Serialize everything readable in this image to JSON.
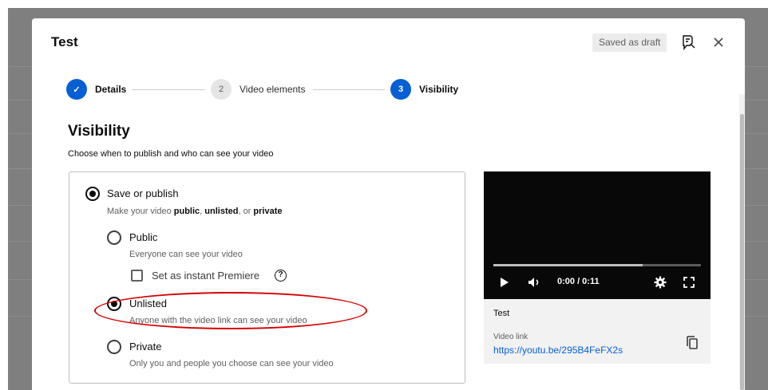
{
  "dialog": {
    "title": "Test",
    "draft_badge": "Saved as draft"
  },
  "header_icons": {
    "send_feedback": "feedback-icon",
    "close": "close-icon"
  },
  "stepper": {
    "steps": [
      {
        "marker": "✓",
        "label": "Details",
        "state": "done"
      },
      {
        "marker": "2",
        "label": "Video elements",
        "state": "todo"
      },
      {
        "marker": "3",
        "label": "Visibility",
        "state": "current"
      }
    ]
  },
  "visibility": {
    "title": "Visibility",
    "subtitle": "Choose when to publish and who can see your video",
    "save_or_publish": {
      "label": "Save or publish",
      "desc_prefix": "Make your video ",
      "desc_public": "public",
      "desc_sep1": ", ",
      "desc_unlisted": "unlisted",
      "desc_sep2": ", or ",
      "desc_private": "private",
      "selected": true
    },
    "options": [
      {
        "label": "Public",
        "desc": "Everyone can see your video",
        "selected": false
      },
      {
        "label": "Unlisted",
        "desc": "Anyone with the video link can see your video",
        "selected": true
      },
      {
        "label": "Private",
        "desc": "Only you and people you choose can see your video",
        "selected": false
      }
    ],
    "premiere": {
      "label": "Set as instant Premiere",
      "checked": false,
      "help": "?"
    }
  },
  "preview": {
    "time": "0:00 / 0:11",
    "progress_fraction": 0.72,
    "title": "Test",
    "link_label": "Video link",
    "link": "https://youtu.be/295B4FeFX2s"
  },
  "colors": {
    "accent": "#065fd4",
    "annotation": "#d50000",
    "player_bg": "#080808"
  }
}
